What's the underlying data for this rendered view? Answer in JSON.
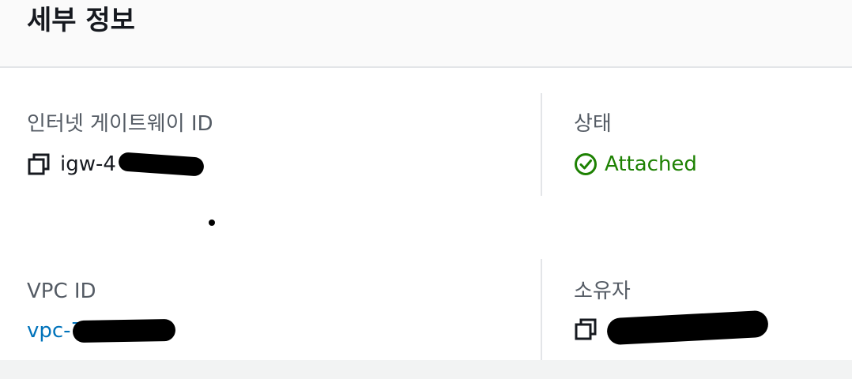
{
  "header": {
    "title": "세부 정보"
  },
  "details": {
    "internet_gateway_id": {
      "label": "인터넷 게이트웨이 ID",
      "value": "igw-4",
      "icon": "copy-icon"
    },
    "status": {
      "label": "상태",
      "value": "Attached",
      "icon": "check-circle-icon",
      "color": "#1d8102"
    },
    "vpc_id": {
      "label": "VPC ID",
      "value": "vpc-7"
    },
    "owner": {
      "label": "소유자",
      "icon": "copy-icon"
    }
  },
  "colors": {
    "link": "#0073bb",
    "label": "#545b64",
    "text": "#16191f"
  }
}
